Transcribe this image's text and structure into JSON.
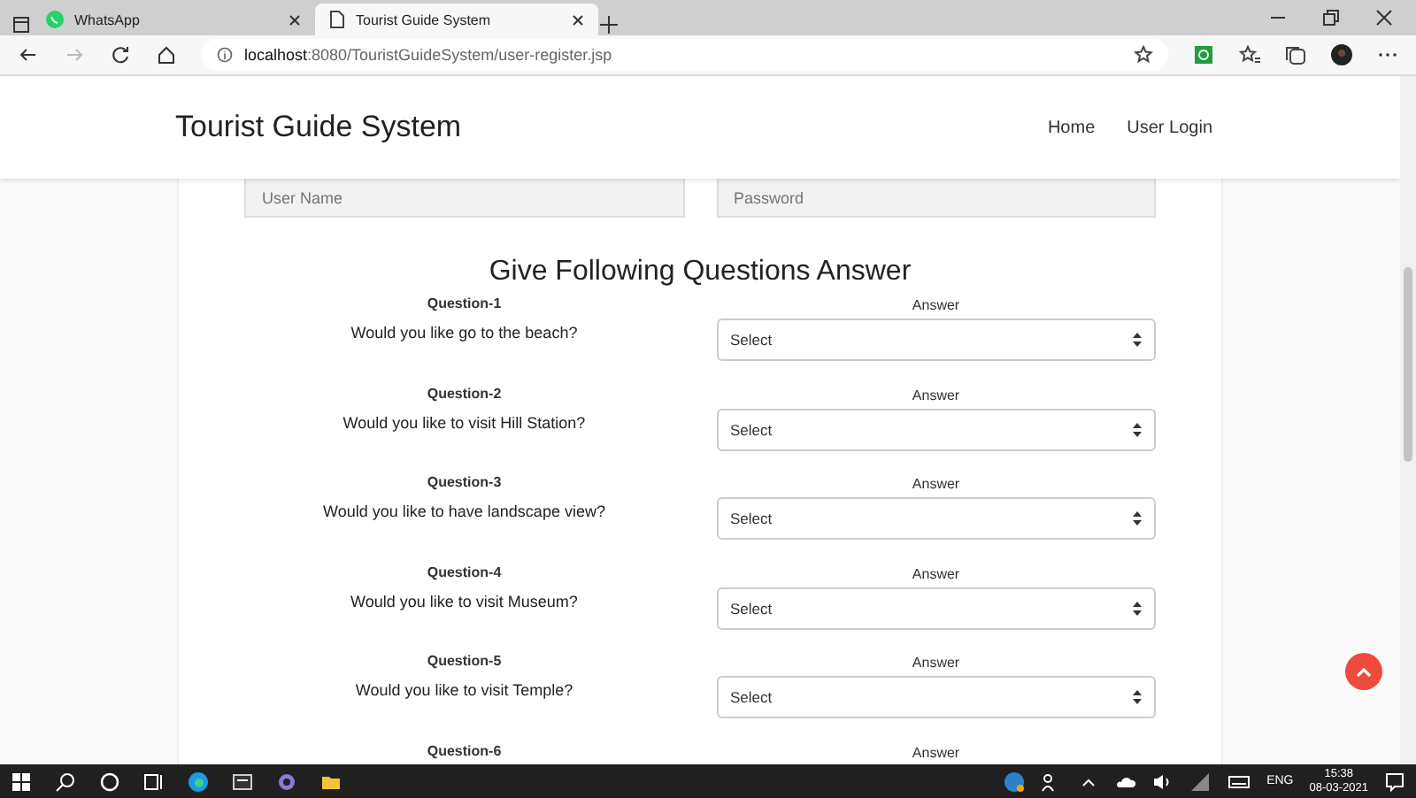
{
  "browser": {
    "tabs": [
      {
        "title": "WhatsApp",
        "selected": false
      },
      {
        "title": "Tourist Guide System",
        "selected": true
      }
    ],
    "address": {
      "host": "localhost",
      "rest": ":8080/TouristGuideSystem/user-register.jsp"
    }
  },
  "header": {
    "brand": "Tourist Guide System",
    "nav": [
      "Home",
      "User Login"
    ]
  },
  "fields": [
    {
      "placeholder": "User Name"
    },
    {
      "placeholder": "Password"
    }
  ],
  "heading": "Give Following Questions Answer",
  "questions": [
    {
      "label": "Question-1",
      "text": "Would you like go to the beach?",
      "answer_label": "Answer",
      "value": "Select"
    },
    {
      "label": "Question-2",
      "text": "Would you like to visit Hill Station?",
      "answer_label": "Answer",
      "value": "Select"
    },
    {
      "label": "Question-3",
      "text": "Would you like to have landscape view?",
      "answer_label": "Answer",
      "value": "Select"
    },
    {
      "label": "Question-4",
      "text": "Would you like to visit Museum?",
      "answer_label": "Answer",
      "value": "Select"
    },
    {
      "label": "Question-5",
      "text": "Would you like to visit Temple?",
      "answer_label": "Answer",
      "value": "Select"
    },
    {
      "label": "Question-6",
      "answer_label": "Answer"
    }
  ],
  "taskbar": {
    "language": "ENG",
    "time": "15:38",
    "date": "08-03-2021"
  }
}
